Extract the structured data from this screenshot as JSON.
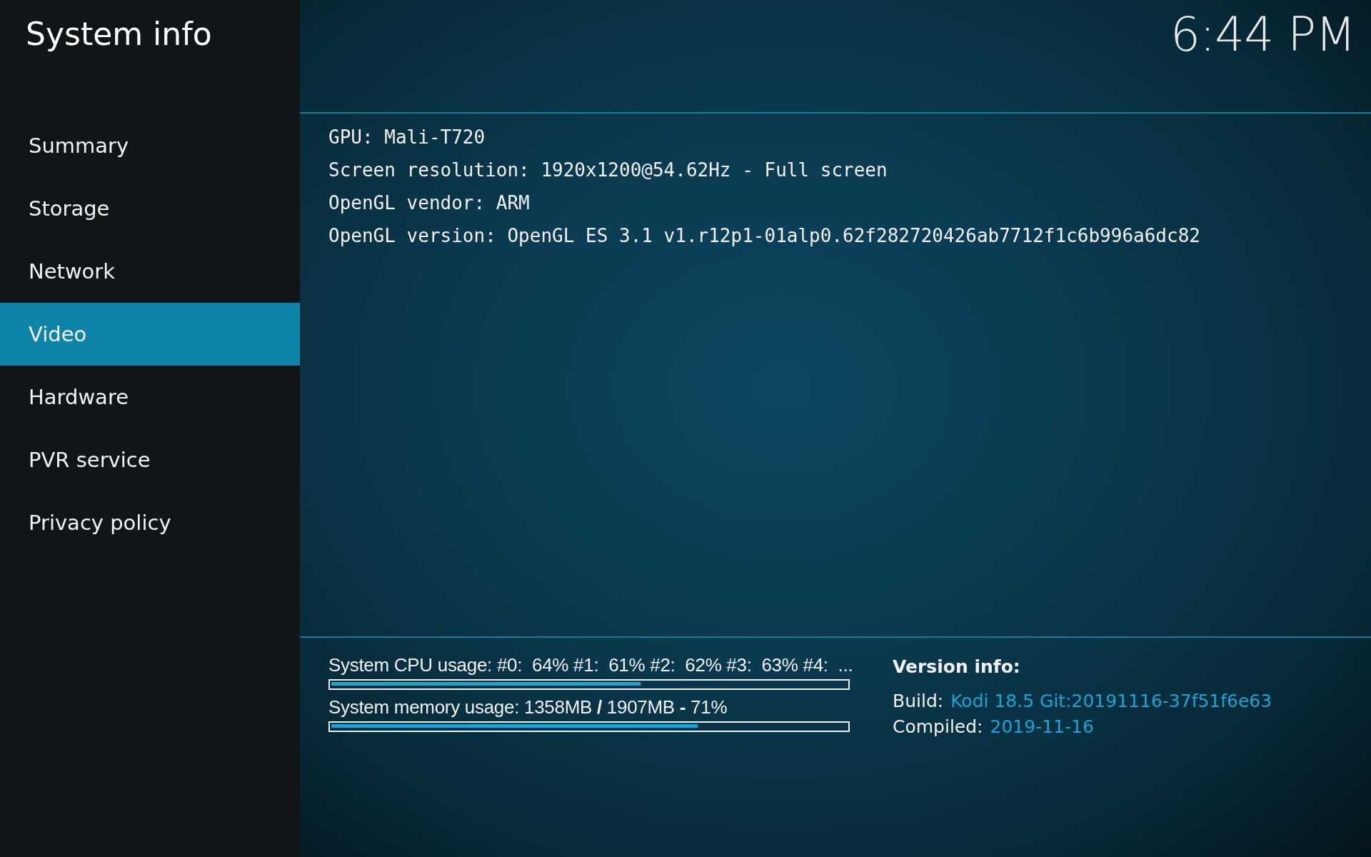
{
  "header": {
    "title": "System info",
    "clock": "6:44 PM"
  },
  "sidebar": {
    "items": [
      {
        "label": "Summary",
        "selected": false
      },
      {
        "label": "Storage",
        "selected": false
      },
      {
        "label": "Network",
        "selected": false
      },
      {
        "label": "Video",
        "selected": true
      },
      {
        "label": "Hardware",
        "selected": false
      },
      {
        "label": "PVR service",
        "selected": false
      },
      {
        "label": "Privacy policy",
        "selected": false
      }
    ]
  },
  "details": [
    "GPU: Mali-T720",
    "Screen resolution: 1920x1200@54.62Hz - Full screen",
    "OpenGL vendor: ARM",
    "OpenGL version: OpenGL ES 3.1 v1.r12p1-01alp0.62f282720426ab7712f1c6b996a6dc82"
  ],
  "usage": [
    {
      "label": "System CPU usage: #0:  64% #1:  61% #2:  62% #3:  63% #4:  ...",
      "level": 0.6
    },
    {
      "label": "System memory usage: 1358MB **/** 1907MB **-** 71%",
      "level": 0.71
    }
  ],
  "version_info": {
    "title": "Version info:",
    "rows": [
      {
        "label": "Build:",
        "value": "Kodi 18.5 Git:20191116-37f51f6e63"
      },
      {
        "label": "Compiled:",
        "value": "2019-11-16"
      }
    ]
  }
}
